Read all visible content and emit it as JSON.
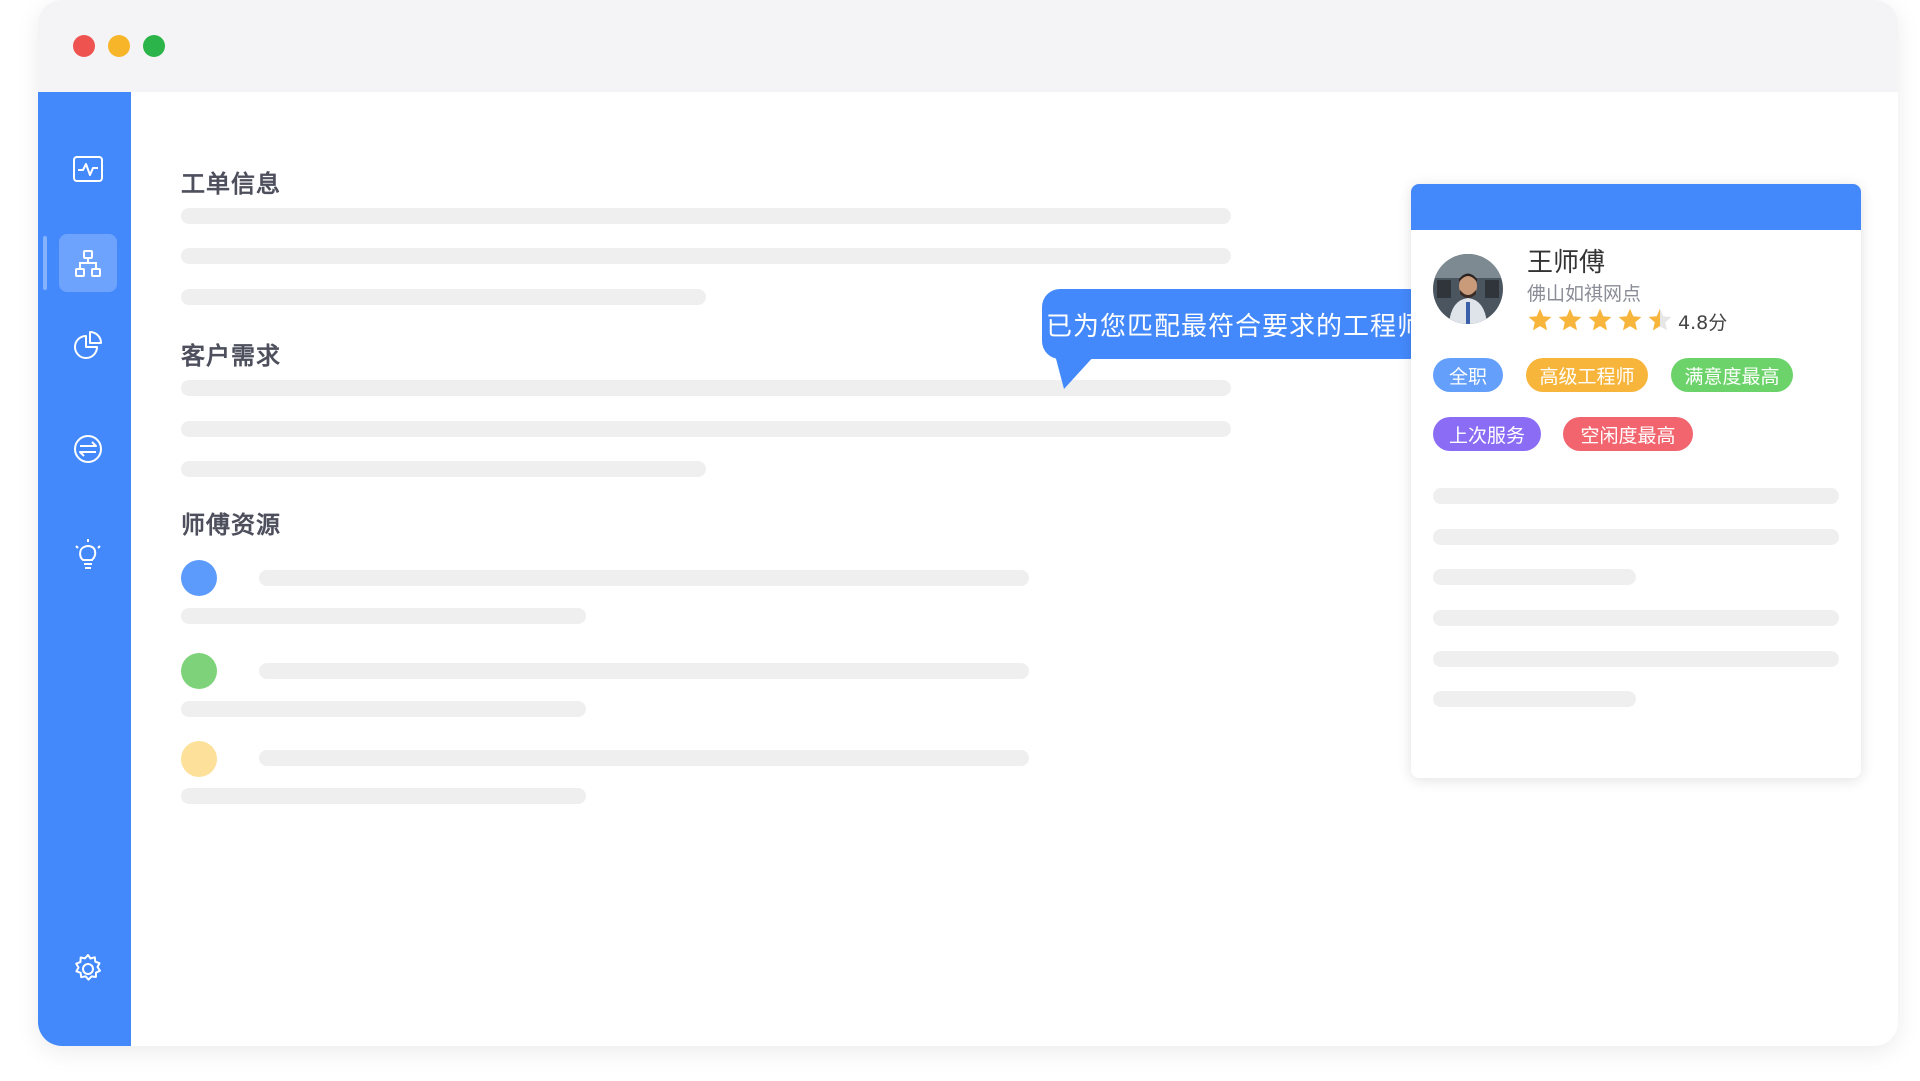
{
  "window": {
    "traffic_lights": [
      "close",
      "minimize",
      "maximize"
    ],
    "colors": {
      "close": "#ef5350",
      "minimize": "#f7b529",
      "maximize": "#2bb449"
    }
  },
  "sidebar": {
    "accent": "#4489fb",
    "items": [
      {
        "icon": "activity-chart-icon",
        "active": false
      },
      {
        "icon": "org-structure-icon",
        "active": true
      },
      {
        "icon": "pie-chart-icon",
        "active": false
      },
      {
        "icon": "exchange-icon",
        "active": false
      },
      {
        "icon": "lightbulb-icon",
        "active": false
      },
      {
        "icon": "gear-icon",
        "active": false
      }
    ]
  },
  "main": {
    "sections": [
      {
        "title": "工单信息"
      },
      {
        "title": "客户需求"
      },
      {
        "title": "师傅资源"
      }
    ],
    "resource_dot_colors": [
      "#5c9bfb",
      "#7ed37a",
      "#fde09a"
    ]
  },
  "bubble": {
    "text": "已为您匹配最符合要求的工程师"
  },
  "engineer_card": {
    "name": "王师傅",
    "branch": "佛山如祺网点",
    "rating": 4.8,
    "rating_text": "4.8分",
    "tags": [
      {
        "label": "全职",
        "color": "#64a0fb"
      },
      {
        "label": "高级工程师",
        "color": "#f8b53b"
      },
      {
        "label": "满意度最高",
        "color": "#6cd36a"
      },
      {
        "label": "上次服务",
        "color": "#8b6df5"
      },
      {
        "label": "空闲度最高",
        "color": "#f2646e"
      }
    ]
  }
}
